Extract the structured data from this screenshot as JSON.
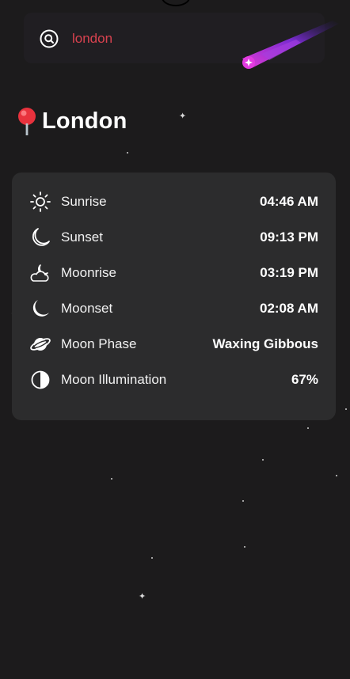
{
  "search": {
    "value": "london",
    "icon": "search-icon"
  },
  "location": {
    "icon": "map-pin-icon",
    "city": "London"
  },
  "astronomy": {
    "rows": [
      {
        "icon": "sun-icon",
        "label": "Sunrise",
        "value": "04:46 AM"
      },
      {
        "icon": "crescent-moon-outline-icon",
        "label": "Sunset",
        "value": "09:13 PM"
      },
      {
        "icon": "moon-cloud-icon",
        "label": "Moonrise",
        "value": "03:19 PM"
      },
      {
        "icon": "crescent-moon-filled-icon",
        "label": "Moonset",
        "value": "02:08 AM"
      },
      {
        "icon": "planet-icon",
        "label": "Moon Phase",
        "value": "Waxing Gibbous"
      },
      {
        "icon": "half-circle-icon",
        "label": "Moon Illumination",
        "value": "67%"
      }
    ]
  },
  "colors": {
    "background": "#1c1b1c",
    "card": "#2c2c2d",
    "search_text": "#d8424f",
    "comet": "#c23bd6"
  }
}
